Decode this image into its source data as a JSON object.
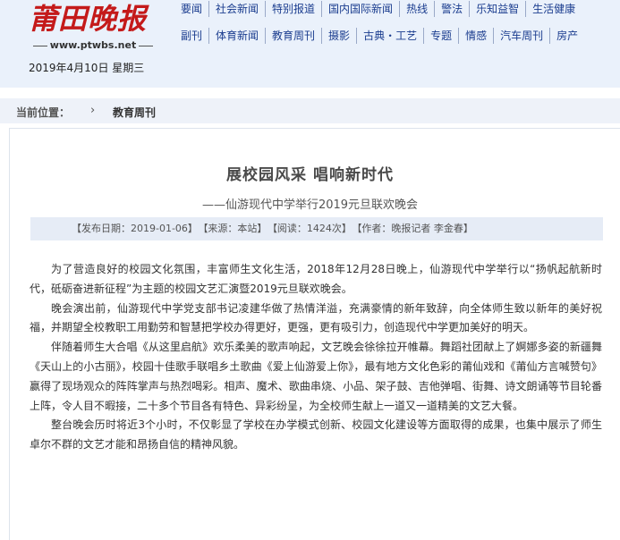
{
  "site": {
    "logo_text": "莆田晚报",
    "url": "www.ptwbs.net",
    "date": "2019年4月10日  星期三"
  },
  "nav": {
    "row1": [
      "要闻",
      "社会新闻",
      "特别报道",
      "国内国际新闻",
      "热线",
      "警法",
      "乐知益智",
      "生活健康"
    ],
    "row2": [
      "副刊",
      "体育新闻",
      "教育周刊",
      "摄影",
      "古典・工艺",
      "专题",
      "情感",
      "汽车周刊",
      "房产"
    ]
  },
  "breadcrumb": {
    "label": "当前位置：",
    "separator": "›",
    "current": "教育周刊"
  },
  "article": {
    "title": "展校园风采  唱响新时代",
    "subtitle": "——仙游现代中学举行2019元旦联欢晚会",
    "meta": {
      "publish_date": "【发布日期：2019-01-06】",
      "source": "【来源：本站】",
      "views": "【阅读：1424次】",
      "author": "【作者：晚报记者  李金春】"
    },
    "paragraphs": [
      "为了营造良好的校园文化氛围，丰富师生文化生活，2018年12月28日晚上，仙游现代中学举行以“扬帆起航新时代，砥砺奋进新征程”为主题的校园文艺汇演暨2019元旦联欢晚会。",
      "晚会演出前，仙游现代中学党支部书记凌建华做了热情洋溢，充满豪情的新年致辞，向全体师生致以新年的美好祝福，并期望全校教职工用勤劳和智慧把学校办得更好，更强，更有吸引力，创造现代中学更加美好的明天。",
      "伴随着师生大合唱《从这里启航》欢乐柔美的歌声响起，文艺晚会徐徐拉开帷幕。舞蹈社团献上了婀娜多姿的新疆舞《天山上的小古丽》，校园十佳歌手联唱乡土歌曲《爱上仙游爱上你》，最有地方文化色彩的莆仙戏和《莆仙方言喊赞句》赢得了现场观众的阵阵掌声与热烈喝彩。相声、魔术、歌曲串烧、小品、架子鼓、吉他弹唱、街舞、诗文朗诵等节目轮番上阵，令人目不暇接，二十多个节目各有特色、异彩纷呈，为全校师生献上一道又一道精美的文艺大餐。",
      "整台晚会历时将近3个小时，不仅彰显了学校在办学模式创新、校园文化建设等方面取得的成果，也集中展示了师生卓尔不群的文艺才能和昂扬自信的精神风貌。"
    ]
  }
}
